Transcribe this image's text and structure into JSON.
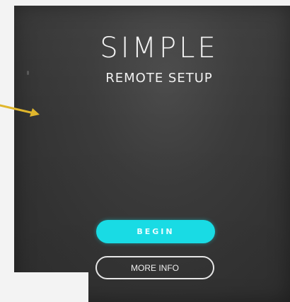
{
  "screen": {
    "title": "SIMPLE",
    "subtitle": "REMOTE SETUP"
  },
  "buttons": {
    "begin_label": "BEGIN",
    "more_info_label": "MORE INFO"
  },
  "colors": {
    "accent": "#19dbe4",
    "screen_background": "#3a3a3a",
    "annotation_arrow": "#e0b62c"
  },
  "icons": {
    "annotation": "arrow-right-icon"
  }
}
